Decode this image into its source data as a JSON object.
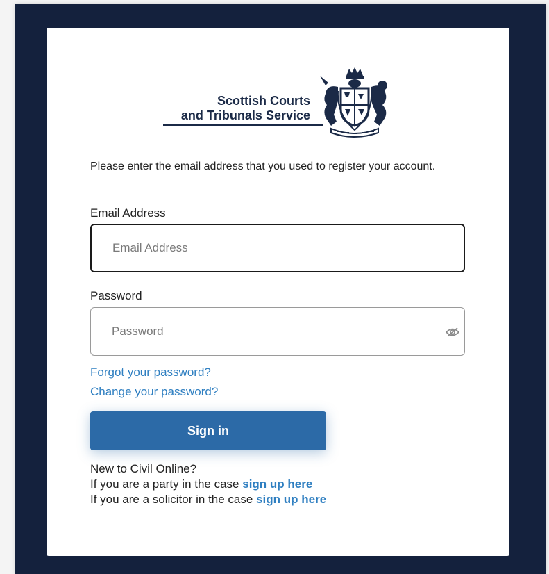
{
  "logo": {
    "line1": "Scottish Courts",
    "line2": "and Tribunals Service"
  },
  "intro": "Please enter the email address that you used to register your account.",
  "email": {
    "label": "Email Address",
    "placeholder": "Email Address",
    "value": ""
  },
  "password": {
    "label": "Password",
    "placeholder": "Password",
    "value": "",
    "toggle_icon": "eye-slash-icon"
  },
  "links": {
    "forgot": "Forgot your password?",
    "change": "Change your password?"
  },
  "signin": {
    "label": "Sign in"
  },
  "footer": {
    "new_text": "New to Civil Online?",
    "party_text": "If you are a party in the case",
    "party_link": "sign up here",
    "solicitor_text": "If you are a solicitor in the case",
    "solicitor_link": "sign up here"
  },
  "colors": {
    "frame": "#14213d",
    "accent": "#2c6aa7",
    "link": "#2f7fc1"
  }
}
